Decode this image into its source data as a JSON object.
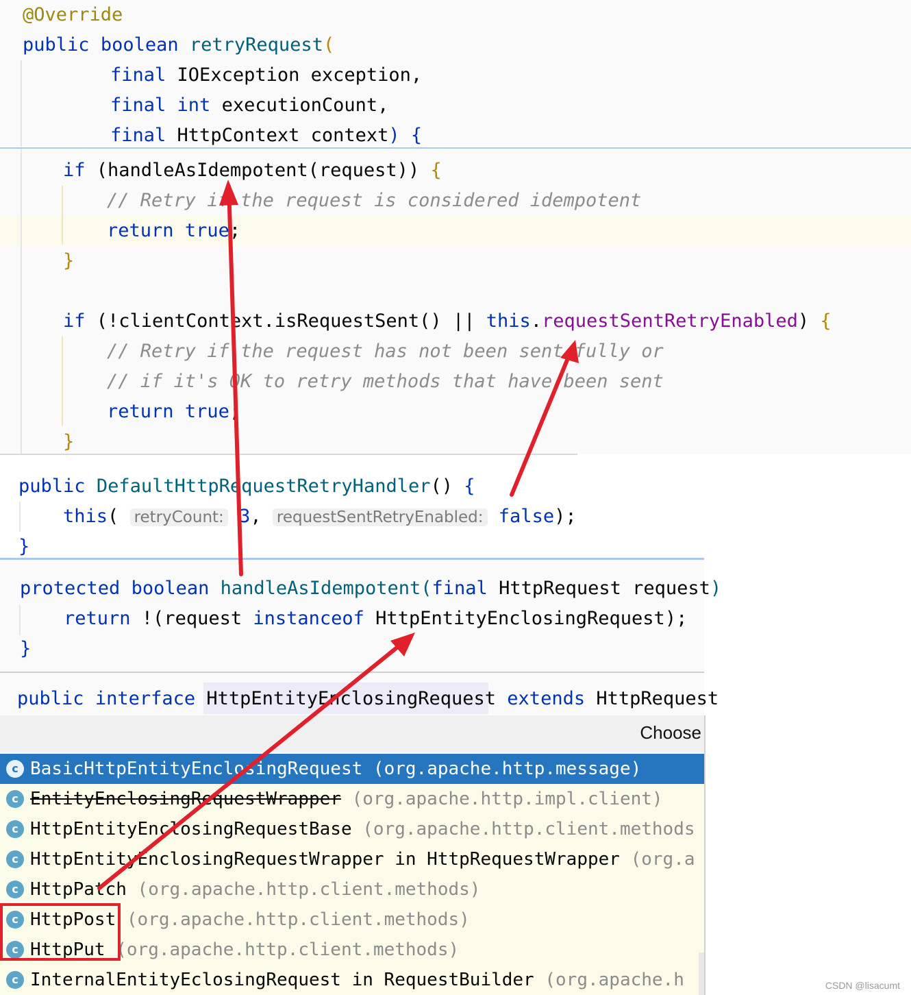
{
  "panel1": {
    "annotation": "@Override",
    "sig_public": "public",
    "sig_boolean": "boolean",
    "sig_method": "retryRequest",
    "sig_paren": "(",
    "p1_final": "final",
    "p1_type": "IOException exception,",
    "p2_final": "final",
    "p2_int": "int",
    "p2_name": "executionCount,",
    "p3_final": "final",
    "p3_type": "HttpContext context",
    "p3_close": ") {",
    "if1_kw": "if",
    "if1_open": " (",
    "if1_call": "handleAsIdempotent",
    "if1_args": "(request))",
    "if1_brace": " {",
    "comment1": "// Retry if the request is considered idempotent",
    "return1_kw": "return",
    "return1_val": "true",
    "return1_semi": ";",
    "close1": "}",
    "if2_kw": "if",
    "if2_open": " (!clientContext.isRequestSent() || ",
    "if2_this": "this",
    "if2_dot": ".",
    "if2_field": "requestSentRetryEnabled",
    "if2_close": ")",
    "if2_brace": " {",
    "comment2": "// Retry if the request has not been sent fully or",
    "comment3": "// if it's OK to retry methods that have been sent",
    "return2_kw": "return",
    "return2_val": "true",
    "return2_semi": ";",
    "close2": "}"
  },
  "panel2": {
    "public_kw": "public",
    "ctor_name": "DefaultHttpRequestRetryHandler",
    "ctor_paren": "()",
    "ctor_brace": " {",
    "this_kw": "this",
    "this_open": "(",
    "hint1": "retryCount:",
    "arg1": "3",
    "comma": ",",
    "hint2": "requestSentRetryEnabled:",
    "arg2": "false",
    "this_close": ");",
    "close": "}"
  },
  "panel3": {
    "protected_kw": "protected",
    "boolean_kw": "boolean",
    "method_name": "handleAsIdempotent",
    "open": "(",
    "final_kw": "final",
    "param": "HttpRequest request",
    "close_paren": ")",
    "return_kw": "return",
    "not": " !(request ",
    "instanceof_kw": "instanceof",
    "type": " HttpEntityEnclosingRequest",
    "end": ");",
    "close": "}"
  },
  "panel4": {
    "public_kw": "public",
    "interface_kw": "interface",
    "iface_name": "HttpEntityEnclosingRequest",
    "extends_kw": "extends",
    "super_name": "HttpRequest",
    "popup_title": "Choose",
    "items": [
      {
        "icon": "c",
        "name": "BasicHttpEntityEnclosingRequest",
        "pkg": "(org.apache.http.message)",
        "selected": true,
        "deprecated": false
      },
      {
        "icon": "c",
        "name": "EntityEnclosingRequestWrapper",
        "pkg": "(org.apache.http.impl.client)",
        "selected": false,
        "deprecated": true
      },
      {
        "icon": "c",
        "name": "HttpEntityEnclosingRequestBase",
        "pkg": "(org.apache.http.client.methods",
        "selected": false,
        "deprecated": false
      },
      {
        "icon": "c",
        "name": "HttpEntityEnclosingRequestWrapper in HttpRequestWrapper",
        "pkg": "(org.a",
        "selected": false,
        "deprecated": false
      },
      {
        "icon": "c",
        "name": "HttpPatch",
        "pkg": "(org.apache.http.client.methods)",
        "selected": false,
        "deprecated": false
      },
      {
        "icon": "c",
        "name": "HttpPost",
        "pkg": "(org.apache.http.client.methods)",
        "selected": false,
        "deprecated": false
      },
      {
        "icon": "c",
        "name": "HttpPut",
        "pkg": "(org.apache.http.client.methods)",
        "selected": false,
        "deprecated": false
      },
      {
        "icon": "c",
        "name": "InternalEntityEclosingRequest in RequestBuilder",
        "pkg": "(org.apache.h",
        "selected": false,
        "deprecated": false
      }
    ]
  },
  "watermark": "CSDN @lisacumt",
  "colors": {
    "keyword": "#0033b3",
    "method": "#00627a",
    "comment": "#8c8c8c",
    "annotation": "#9e880d",
    "field": "#871094",
    "selection": "#2675bf",
    "arrow": "#e0202a",
    "popup_bg": "#f7f8fa"
  }
}
